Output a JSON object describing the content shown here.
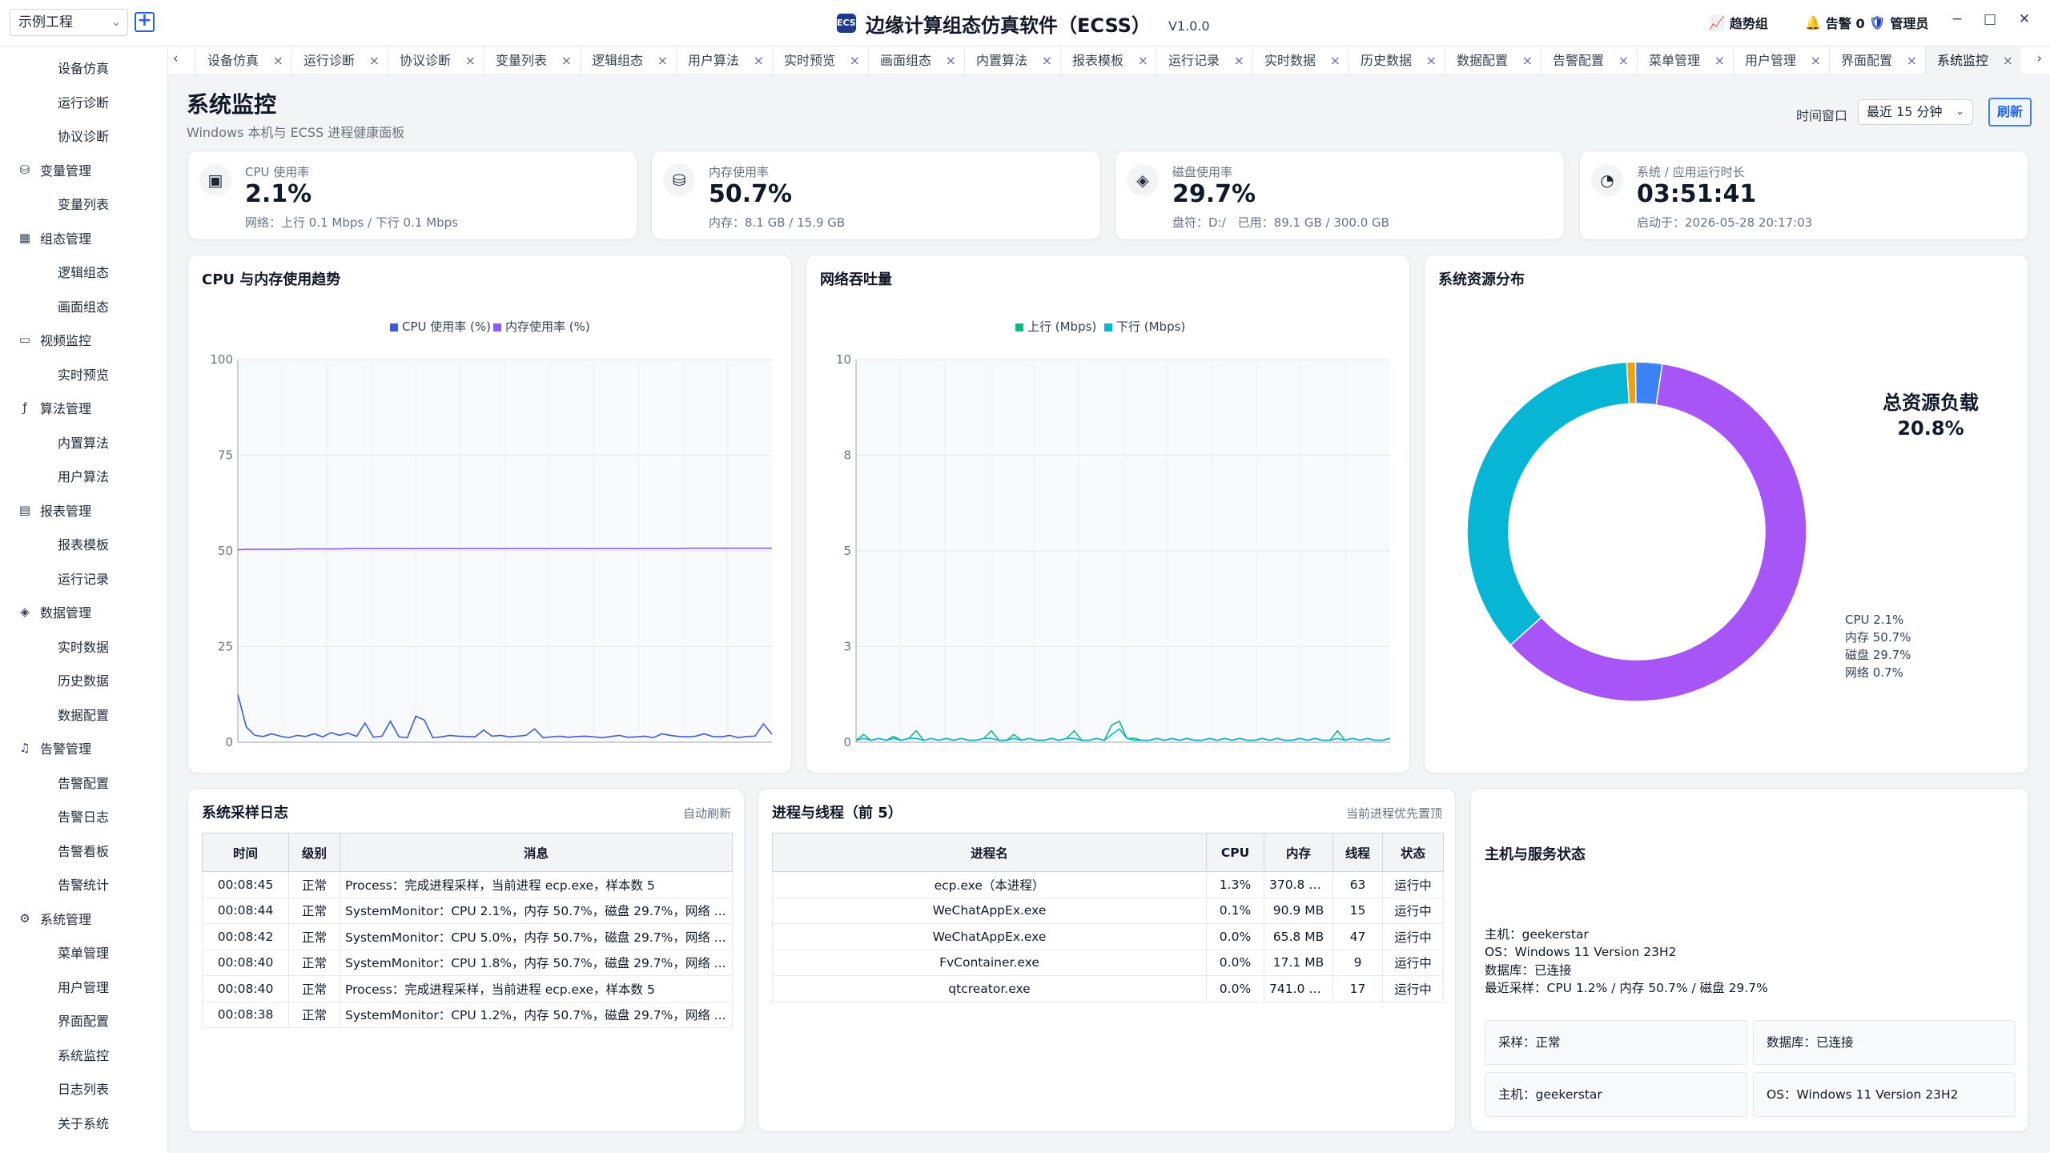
{
  "titlebar": {
    "project_select": "示例工程",
    "add_icon": "plus-square-icon",
    "app_logo": "ECSS",
    "app_title": "边缘计算组态仿真软件（ECSS）",
    "version": "V1.0.0",
    "trend_label": "趋势组",
    "alarm_label": "告警 0",
    "user_label": "管理员",
    "minimize": "−",
    "maximize": "□",
    "close": "✕"
  },
  "sidebar": {
    "groups": [
      {
        "label": "设备仿真",
        "icon": "device-icon",
        "items": [
          "设备仿真",
          "运行诊断",
          "协议诊断"
        ]
      },
      {
        "label": "变量管理",
        "icon": "database-icon",
        "items": [
          "变量列表"
        ]
      },
      {
        "label": "组态管理",
        "icon": "grid-icon",
        "items": [
          "逻辑组态",
          "画面组态"
        ]
      },
      {
        "label": "视频监控",
        "icon": "folder-icon",
        "items": [
          "实时预览"
        ]
      },
      {
        "label": "算法管理",
        "icon": "function-icon",
        "items": [
          "内置算法",
          "用户算法"
        ]
      },
      {
        "label": "报表管理",
        "icon": "report-icon",
        "items": [
          "报表模板",
          "运行记录"
        ]
      },
      {
        "label": "数据管理",
        "icon": "layers-icon",
        "items": [
          "实时数据",
          "历史数据",
          "数据配置"
        ]
      },
      {
        "label": "告警管理",
        "icon": "bell-icon",
        "items": [
          "告警配置",
          "告警日志",
          "告警看板",
          "告警统计"
        ]
      },
      {
        "label": "系统管理",
        "icon": "gear-icon",
        "items": [
          "菜单管理",
          "用户管理",
          "界面配置",
          "系统监控",
          "日志列表",
          "关于系统"
        ]
      }
    ]
  },
  "tabs": [
    "设备仿真",
    "运行诊断",
    "协议诊断",
    "变量列表",
    "逻辑组态",
    "用户算法",
    "实时预览",
    "画面组态",
    "内置算法",
    "报表模板",
    "运行记录",
    "实时数据",
    "历史数据",
    "数据配置",
    "告警配置",
    "菜单管理",
    "用户管理",
    "界面配置",
    "系统监控"
  ],
  "active_tab": "系统监控",
  "page": {
    "title": "系统监控",
    "subtitle": "Windows 本机与 ECSS 进程健康面板",
    "time_window_label": "时间窗口",
    "time_window_value": "最近 15 分钟",
    "refresh_label": "刷新"
  },
  "kpis": [
    {
      "icon": "cpu-icon",
      "label": "CPU 使用率",
      "value": "2.1%",
      "sub": "网络：上行 0.1 Mbps / 下行 0.1 Mbps"
    },
    {
      "icon": "database-icon",
      "label": "内存使用率",
      "value": "50.7%",
      "sub": "内存：8.1 GB / 15.9 GB"
    },
    {
      "icon": "layers-icon",
      "label": "磁盘使用率",
      "value": "29.7%",
      "sub": "盘符：D:/　已用：89.1 GB / 300.0 GB"
    },
    {
      "icon": "gauge-icon",
      "label": "系统 / 应用运行时长",
      "value": "03:51:41",
      "sub": "启动于：2026-05-28 20:17:03"
    }
  ],
  "charts": {
    "cpu_mem_title": "CPU 与内存使用趋势",
    "net_title": "网络吞吐量",
    "dist_title": "系统资源分布",
    "dist_center_label": "总资源负载",
    "dist_center_value": "20.8%"
  },
  "chart_data": [
    {
      "type": "line",
      "title": "CPU 与内存使用趋势",
      "ylim": [
        0,
        100
      ],
      "yticks": [
        "0",
        "25",
        "50",
        "75",
        "100"
      ],
      "grid": true,
      "legend_position": "top",
      "series": [
        {
          "name": "CPU 使用率 (%)",
          "color": "#3b5bdb",
          "values": [
            12.5,
            4,
            1.8,
            1.5,
            2.2,
            1.6,
            1.2,
            1.8,
            1.5,
            2.2,
            1.4,
            2.5,
            1.8,
            2.4,
            1.5,
            5,
            1.3,
            1.6,
            5.5,
            1.4,
            1.2,
            6.8,
            5.8,
            1.2,
            1.4,
            1.8,
            1.6,
            1.5,
            1.4,
            3.2,
            1.6,
            1.8,
            1.4,
            1.6,
            1.8,
            3.5,
            1.2,
            1.4,
            1.6,
            1.3,
            1.5,
            1.6,
            1.4,
            1.2,
            1.5,
            1.8,
            1.3,
            1.4,
            1.6,
            1.2,
            2.2,
            1.8,
            1.5,
            1.4,
            1.6,
            2.2,
            1.5,
            1.4,
            1.8,
            1.2,
            1.5,
            1.6,
            4.8,
            2.1
          ]
        },
        {
          "name": "内存使用率 (%)",
          "color": "#8b5cf6",
          "values": [
            50.3,
            50.4,
            50.4,
            50.4,
            50.4,
            50.4,
            50.4,
            50.5,
            50.5,
            50.5,
            50.5,
            50.5,
            50.5,
            50.6,
            50.6,
            50.6,
            50.6,
            50.6,
            50.6,
            50.6,
            50.6,
            50.6,
            50.6,
            50.6,
            50.6,
            50.6,
            50.6,
            50.6,
            50.6,
            50.6,
            50.6,
            50.6,
            50.6,
            50.6,
            50.6,
            50.6,
            50.6,
            50.6,
            50.6,
            50.6,
            50.6,
            50.6,
            50.6,
            50.6,
            50.6,
            50.6,
            50.6,
            50.6,
            50.6,
            50.6,
            50.6,
            50.6,
            50.6,
            50.7,
            50.7,
            50.7,
            50.7,
            50.7,
            50.7,
            50.7,
            50.7,
            50.7,
            50.7,
            50.7
          ]
        }
      ]
    },
    {
      "type": "line",
      "title": "网络吞吐量",
      "ylim": [
        0,
        10
      ],
      "yticks": [
        "0",
        "3",
        "5",
        "8",
        "10"
      ],
      "grid": true,
      "legend_position": "top",
      "series": [
        {
          "name": "上行 (Mbps)",
          "color": "#10b981",
          "values": [
            0.05,
            0.2,
            0.05,
            0.1,
            0.05,
            0.15,
            0.05,
            0.1,
            0.3,
            0.05,
            0.1,
            0.05,
            0.1,
            0.05,
            0.1,
            0.05,
            0.05,
            0.1,
            0.3,
            0.05,
            0.05,
            0.2,
            0.05,
            0.1,
            0.05,
            0.05,
            0.1,
            0.05,
            0.1,
            0.3,
            0.05,
            0.05,
            0.1,
            0.05,
            0.45,
            0.55,
            0.1,
            0.1,
            0.05,
            0.05,
            0.1,
            0.05,
            0.1,
            0.05,
            0.1,
            0.05,
            0.05,
            0.1,
            0.05,
            0.1,
            0.05,
            0.1,
            0.05,
            0.05,
            0.1,
            0.05,
            0.1,
            0.05,
            0.05,
            0.1,
            0.05,
            0.1,
            0.05,
            0.05,
            0.3,
            0.05,
            0.1,
            0.05,
            0.1,
            0.05,
            0.05,
            0.1
          ]
        },
        {
          "name": "下行 (Mbps)",
          "color": "#06b6d4",
          "values": [
            0.05,
            0.1,
            0.05,
            0.1,
            0.05,
            0.1,
            0.05,
            0.1,
            0.1,
            0.05,
            0.1,
            0.05,
            0.1,
            0.05,
            0.1,
            0.05,
            0.05,
            0.1,
            0.1,
            0.05,
            0.05,
            0.1,
            0.05,
            0.1,
            0.05,
            0.05,
            0.1,
            0.05,
            0.1,
            0.1,
            0.05,
            0.05,
            0.1,
            0.05,
            0.2,
            0.35,
            0.1,
            0.05,
            0.05,
            0.05,
            0.1,
            0.05,
            0.1,
            0.05,
            0.1,
            0.05,
            0.05,
            0.1,
            0.05,
            0.1,
            0.05,
            0.1,
            0.05,
            0.05,
            0.1,
            0.05,
            0.1,
            0.05,
            0.05,
            0.1,
            0.05,
            0.1,
            0.05,
            0.05,
            0.1,
            0.05,
            0.1,
            0.05,
            0.1,
            0.05,
            0.05,
            0.1
          ]
        }
      ]
    },
    {
      "type": "pie",
      "title": "系统资源分布",
      "labels": [
        "CPU",
        "内存",
        "磁盘",
        "网络"
      ],
      "values": [
        2.1,
        50.7,
        29.7,
        0.7
      ],
      "label_texts": [
        "CPU 2.1%",
        "内存 50.7%",
        "磁盘 29.7%",
        "网络 0.7%"
      ],
      "colors": [
        "#3b82f6",
        "#a855f7",
        "#06b6d4",
        "#f59e0b"
      ]
    }
  ],
  "log": {
    "title": "系统采样日志",
    "note": "自动刷新",
    "headers": [
      "时间",
      "级别",
      "消息"
    ],
    "rows": [
      [
        "00:08:45",
        "正常",
        "Process：完成进程采样，当前进程 ecp.exe，样本数 5"
      ],
      [
        "00:08:44",
        "正常",
        "SystemMonitor：CPU 2.1%，内存 50.7%，磁盘 29.7%，网络 ..."
      ],
      [
        "00:08:42",
        "正常",
        "SystemMonitor：CPU 5.0%，内存 50.7%，磁盘 29.7%，网络 ..."
      ],
      [
        "00:08:40",
        "正常",
        "SystemMonitor：CPU 1.8%，内存 50.7%，磁盘 29.7%，网络 ..."
      ],
      [
        "00:08:40",
        "正常",
        "Process：完成进程采样，当前进程 ecp.exe，样本数 5"
      ],
      [
        "00:08:38",
        "正常",
        "SystemMonitor：CPU 1.2%，内存 50.7%，磁盘 29.7%，网络 ..."
      ]
    ]
  },
  "processes": {
    "title": "进程与线程（前 5）",
    "note": "当前进程优先置顶",
    "headers": [
      "进程名",
      "CPU",
      "内存",
      "线程",
      "状态"
    ],
    "rows": [
      [
        "ecp.exe（本进程）",
        "1.3%",
        "370.8 MB",
        "63",
        "运行中"
      ],
      [
        "WeChatAppEx.exe",
        "0.1%",
        "90.9 MB",
        "15",
        "运行中"
      ],
      [
        "WeChatAppEx.exe",
        "0.0%",
        "65.8 MB",
        "47",
        "运行中"
      ],
      [
        "FvContainer.exe",
        "0.0%",
        "17.1 MB",
        "9",
        "运行中"
      ],
      [
        "qtcreator.exe",
        "0.0%",
        "741.0 MB",
        "17",
        "运行中"
      ]
    ]
  },
  "host": {
    "title": "主机与服务状态",
    "lines": [
      "主机：geekerstar",
      "OS：Windows 11 Version 23H2",
      "数据库：已连接",
      "最近采样：CPU 1.2% / 内存 50.7% / 磁盘 29.7%"
    ],
    "boxes": [
      "采样：正常",
      "数据库：已连接",
      "主机：geekerstar",
      "OS：Windows 11 Version 23H2"
    ]
  }
}
